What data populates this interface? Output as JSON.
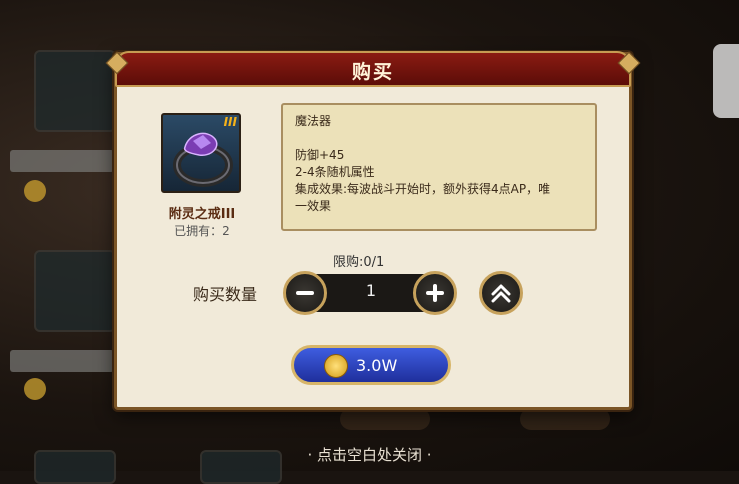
{
  "dialog": {
    "title": "购买",
    "item": {
      "name": "附灵之戒III",
      "badge": "III",
      "owned": "已拥有：2",
      "icon": "amethyst-ring-icon"
    },
    "description": [
      "魔法器",
      "",
      "防御+45",
      "2-4条随机属性",
      "集成效果:每波战斗开始时，额外获得4点AP，唯",
      "一效果"
    ],
    "limit": "限购:0/1",
    "quantity_label": "购买数量",
    "quantity": "1",
    "price": "3.0W"
  },
  "close_hint": "· 点击空白处关闭 ·",
  "colors": {
    "header": "#7a1710",
    "panel": "#f1ead9",
    "buy_button": "#2f45c4",
    "gold": "#d7b568"
  }
}
